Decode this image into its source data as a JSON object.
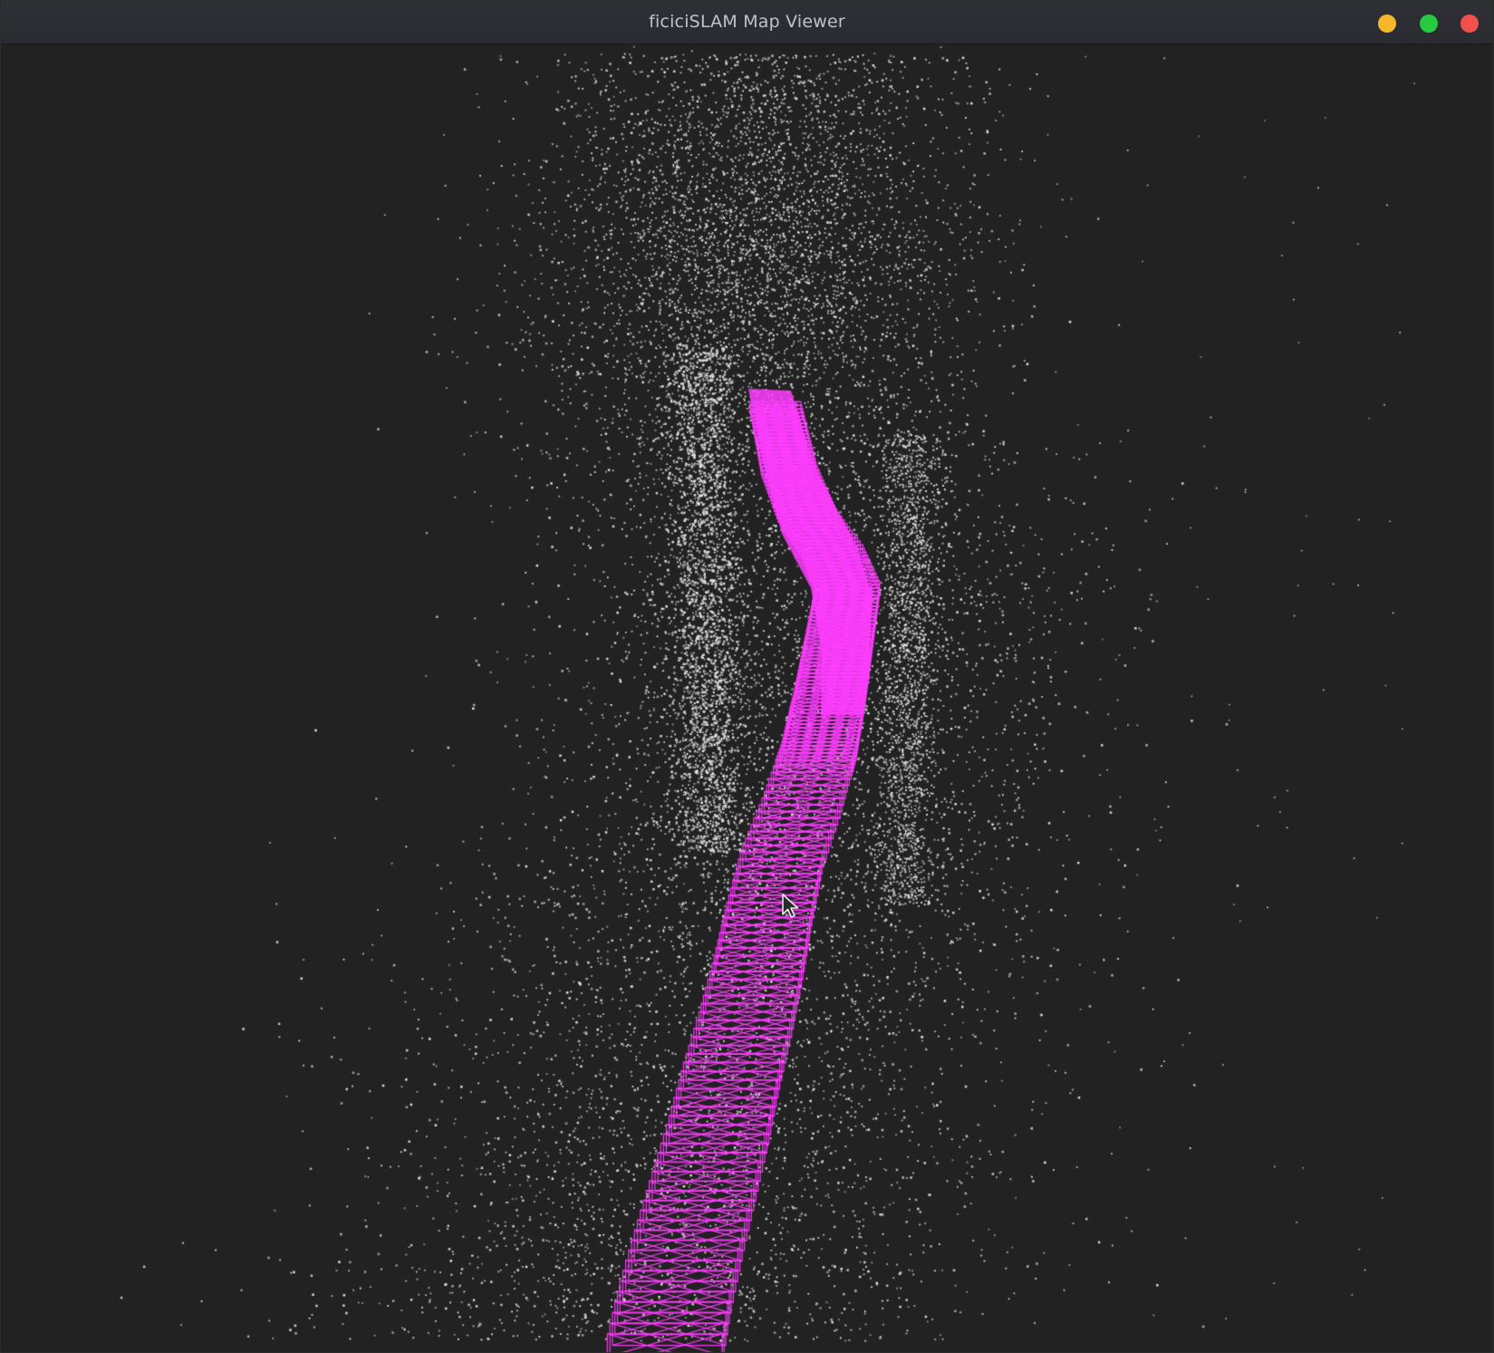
{
  "window": {
    "title": "ficiciSLAM Map Viewer",
    "controls": [
      {
        "name": "minimize",
        "color": "#f5b72b"
      },
      {
        "name": "maximize",
        "color": "#27c93f"
      },
      {
        "name": "close",
        "color": "#f0514d"
      }
    ]
  },
  "colors": {
    "background": "#222222",
    "map_points": "#e6e6e6",
    "keyframes": "#ff3dff"
  },
  "icons": {
    "cursor": "mouse-pointer-icon"
  }
}
